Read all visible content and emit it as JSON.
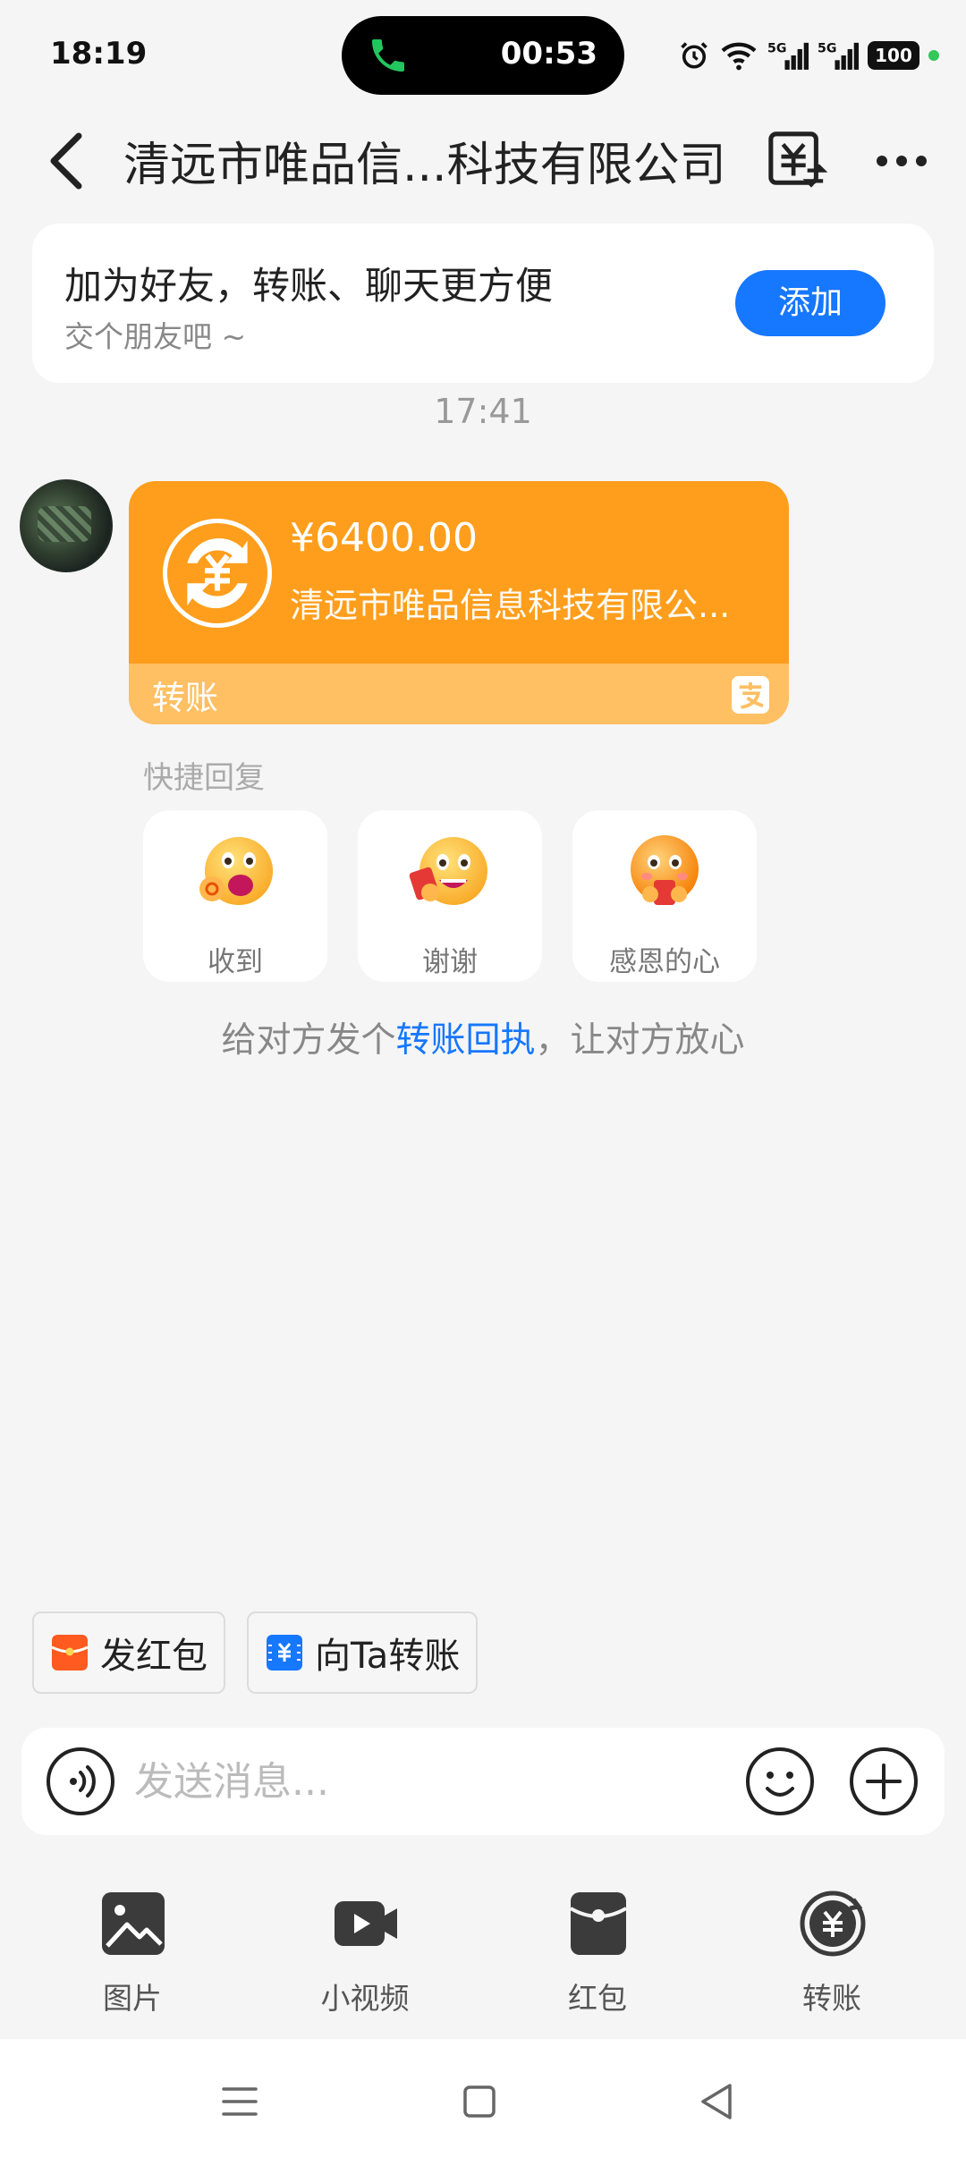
{
  "status_bar": {
    "time": "18:19",
    "call_timer": "00:53",
    "battery": "100",
    "icons": [
      "phone-icon",
      "alarm-icon",
      "wifi-icon",
      "5g-signal-icon",
      "5g-signal-icon",
      "battery-icon"
    ]
  },
  "header": {
    "title": "清远市唯品信...科技有限公司",
    "icons": [
      "back-icon",
      "bill-icon",
      "more-icon"
    ]
  },
  "friend_prompt": {
    "title": "加为好友，转账、聊天更方便",
    "subtitle": "交个朋友吧 ~",
    "add_label": "添加"
  },
  "chat": {
    "time": "17:41",
    "transfer": {
      "amount": "¥6400.00",
      "company": "清远市唯品信息科技有限公...",
      "label": "转账"
    },
    "quick_reply_label": "快捷回复",
    "quick_replies": [
      {
        "label": "收到",
        "emoji": "ok-hand-emoji"
      },
      {
        "label": "谢谢",
        "emoji": "red-envelope-grin-emoji"
      },
      {
        "label": "感恩的心",
        "emoji": "grateful-emoji"
      }
    ],
    "receipt_hint_before": "给对方发个",
    "receipt_hint_link": "转账回执",
    "receipt_hint_after": "，让对方放心"
  },
  "shortcuts": {
    "red_packet": "发红包",
    "transfer_to": "向Ta转账"
  },
  "input": {
    "placeholder": "发送消息..."
  },
  "toolbar": {
    "items": [
      {
        "label": "图片",
        "icon": "image-icon"
      },
      {
        "label": "小视频",
        "icon": "video-icon"
      },
      {
        "label": "红包",
        "icon": "red-packet-icon"
      },
      {
        "label": "转账",
        "icon": "transfer-icon"
      }
    ]
  },
  "nav": {
    "icons": [
      "menu-icon",
      "home-icon",
      "back-triangle-icon"
    ]
  },
  "colors": {
    "accent_blue": "#1677ff",
    "transfer_orange": "#fe9e1c",
    "transfer_orange_light": "#ffbf63"
  }
}
